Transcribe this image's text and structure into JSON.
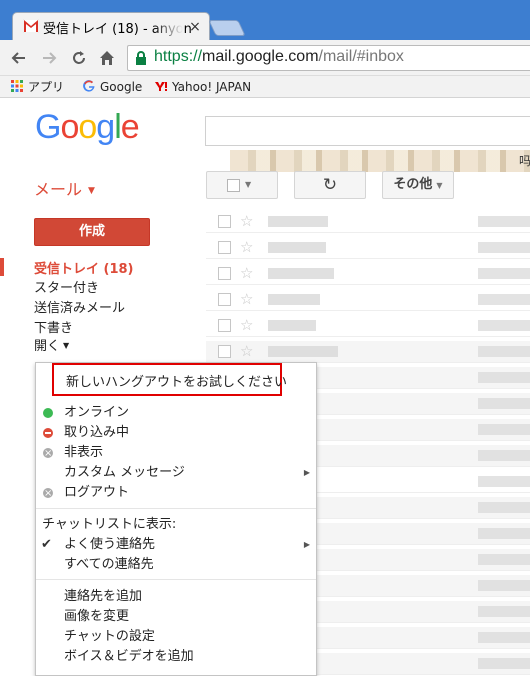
{
  "browser": {
    "tab_title": "受信トレイ (18) - anyon",
    "tab_close": "×",
    "url_scheme": "https://",
    "url_host": "mail.google.com",
    "url_path": "/mail/#inbox"
  },
  "bookmarks": [
    {
      "label": "アプリ",
      "icon": "apps-grid-icon"
    },
    {
      "label": "Google",
      "icon": "google-g-icon"
    },
    {
      "label": "Yahoo! JAPAN",
      "icon": "yahoo-icon"
    }
  ],
  "gmail": {
    "logo": [
      "G",
      "o",
      "o",
      "g",
      "l",
      "e"
    ],
    "app_switcher": "メール",
    "compose": "作成",
    "nav": [
      {
        "label": "受信トレイ (18)"
      },
      {
        "label": "スター付き"
      },
      {
        "label": "送信済みメール"
      },
      {
        "label": "下書き"
      },
      {
        "label": "開く"
      }
    ],
    "toolbar": {
      "refresh_glyph": "↻",
      "more": "その他"
    },
    "row_star": "☆",
    "right_edge_date": "吗"
  },
  "chat_menu": {
    "try_hangouts": "新しいハングアウトをお試しください",
    "status": [
      {
        "label": "オンライン",
        "dot": "green"
      },
      {
        "label": "取り込み中",
        "dot": "red"
      },
      {
        "label": "非表示",
        "dot": "gray"
      },
      {
        "label": "カスタム メッセージ",
        "dot": "none"
      },
      {
        "label": "ログアウト",
        "dot": "gray"
      }
    ],
    "show_heading": "チャットリストに表示:",
    "show_options": [
      {
        "label": "よく使う連絡先",
        "checked": true
      },
      {
        "label": "すべての連絡先",
        "checked": false
      }
    ],
    "actions": [
      {
        "label": "連絡先を追加"
      },
      {
        "label": "画像を変更"
      },
      {
        "label": "チャットの設定"
      },
      {
        "label": "ボイス＆ビデオを追加"
      }
    ]
  },
  "colors": {
    "accent_red": "#dd4b39",
    "compose_red": "#d14836",
    "chrome_blue": "#3d7ed0",
    "highlight_red": "#e00000"
  }
}
